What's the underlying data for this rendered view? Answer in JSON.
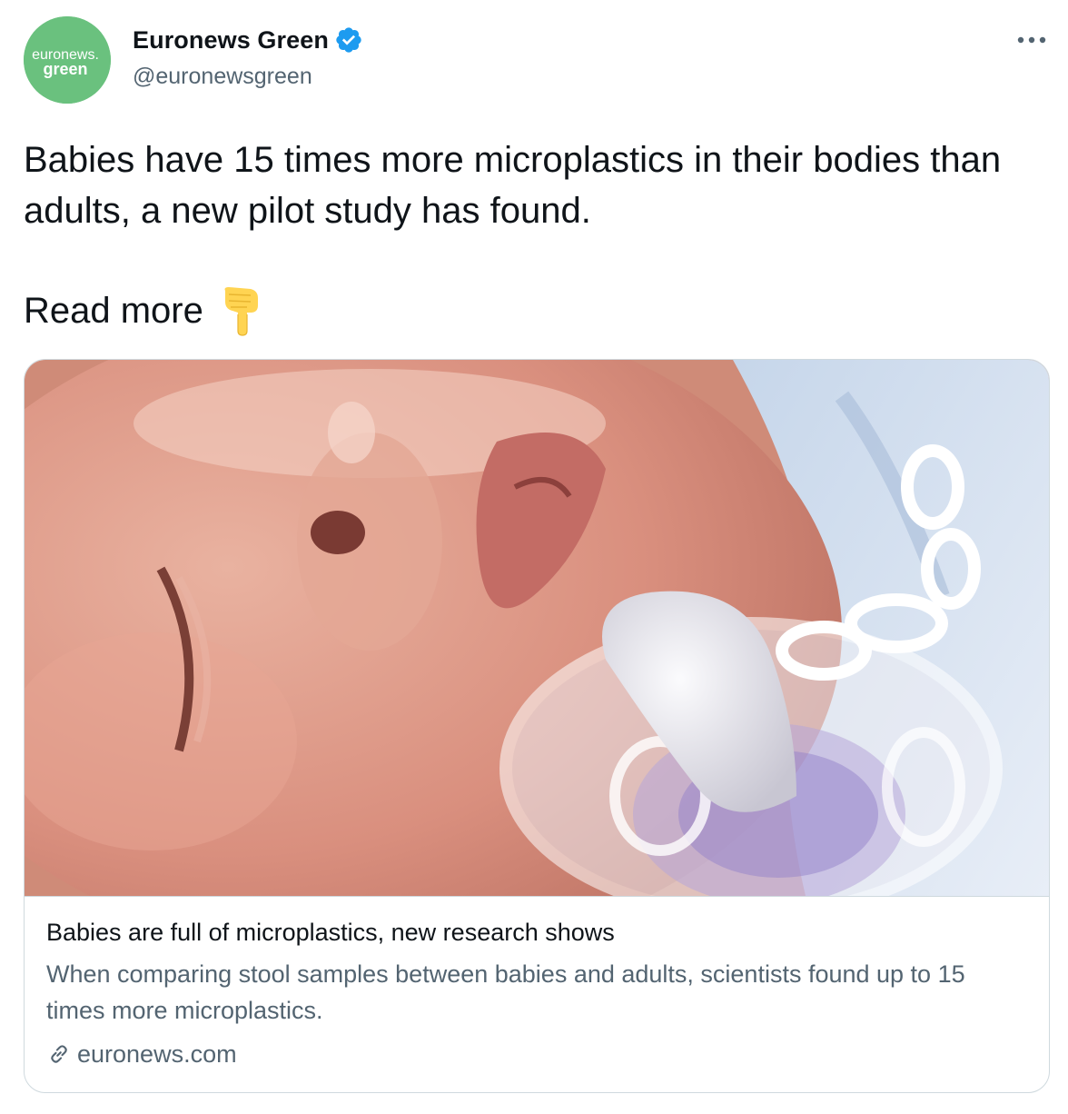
{
  "account": {
    "avatar_top": "euronews.",
    "avatar_bottom": "green",
    "display_name": "Euronews Green",
    "handle": "@euronewsgreen",
    "verified_icon": "verified-badge-icon",
    "avatar_color": "#6ac17e"
  },
  "tweet": {
    "text": "Babies have 15 times more microplastics in their bodies than adults, a new pilot study has found.",
    "read_more": "Read more",
    "emoji": "backhand-index-pointing-down-icon"
  },
  "card": {
    "image_icon": "baby-with-pacifier-image",
    "title": "Babies are full of microplastics, new research shows",
    "description": "When comparing stool samples between babies and adults, scientists found up to 15 times more microplastics.",
    "domain": "euronews.com"
  },
  "colors": {
    "text_primary": "#0f1419",
    "text_secondary": "#536471",
    "verified_blue": "#1d9bf0",
    "border": "#cfd9de"
  }
}
